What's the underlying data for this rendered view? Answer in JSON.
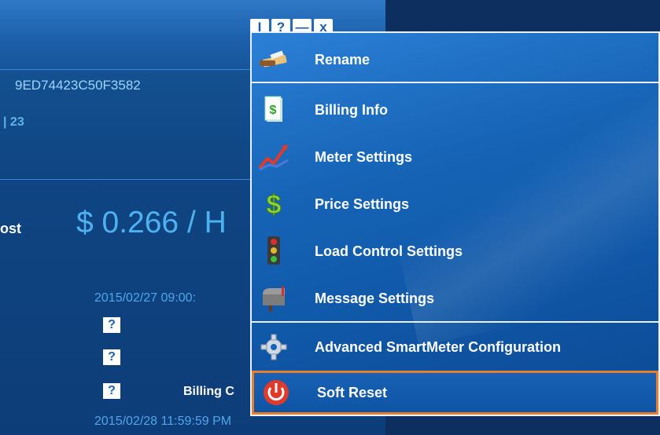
{
  "window": {
    "buttons": [
      "I",
      "?",
      "—",
      "x"
    ]
  },
  "device": {
    "id": "9ED74423C50F3582",
    "sub": "| 23",
    "cost_label": "ost",
    "cost_value": "$ 0.266 / H",
    "date_start": "2015/02/27 09:00:",
    "billing_label": "Billing C",
    "date_end": "2015/02/28 11:59:59 PM",
    "help": [
      "?",
      "?",
      "?"
    ]
  },
  "menu": {
    "items": [
      {
        "label": "Rename",
        "icon": "rename-icon"
      },
      {
        "label": "Billing Info",
        "icon": "billing-info-icon"
      },
      {
        "label": "Meter Settings",
        "icon": "meter-chart-icon"
      },
      {
        "label": "Price Settings",
        "icon": "dollar-icon"
      },
      {
        "label": "Load Control Settings",
        "icon": "traffic-light-icon"
      },
      {
        "label": "Message Settings",
        "icon": "mailbox-icon"
      },
      {
        "label": "Advanced SmartMeter Configuration",
        "icon": "gear-icon"
      },
      {
        "label": "Soft Reset",
        "icon": "power-icon"
      }
    ],
    "highlight_color": "#e57f2e"
  }
}
